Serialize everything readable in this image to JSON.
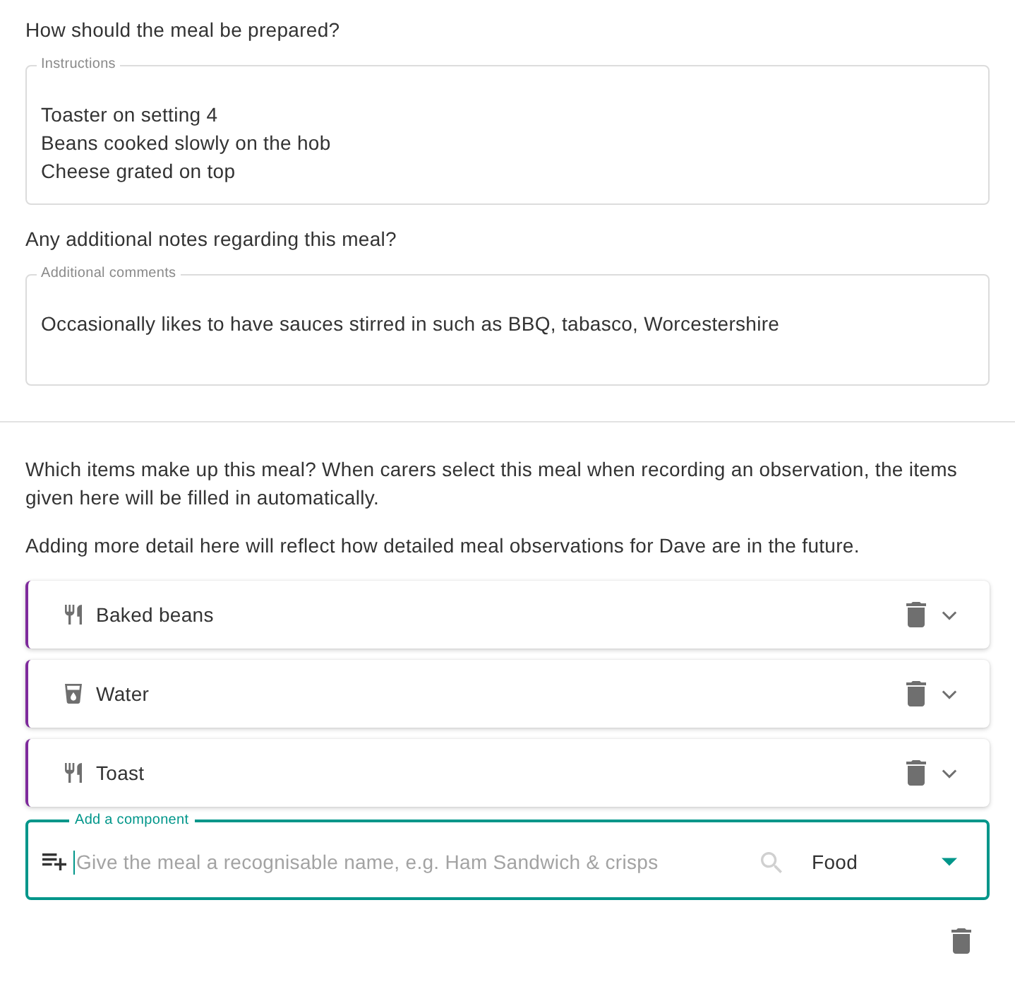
{
  "preparation": {
    "question": "How should the meal be prepared?",
    "field": {
      "label": "Instructions",
      "value": "Toaster on setting 4\nBeans cooked slowly on the hob\nCheese grated on top"
    }
  },
  "notes": {
    "question": "Any additional notes regarding this meal?",
    "field": {
      "label": "Additional comments",
      "value": "Occasionally likes to have sauces stirred in such as BBQ, tabasco, Worcestershire"
    }
  },
  "components_intro": [
    "Which items make up this meal? When carers select this meal when recording an observation, the items given here will be filled in automatically.",
    "Adding more detail here will reflect how detailed meal observations for Dave are in the future."
  ],
  "components": [
    {
      "name": "Baked beans",
      "kind": "food",
      "expanded": false
    },
    {
      "name": "Water",
      "kind": "drink",
      "expanded": false
    },
    {
      "name": "Toast",
      "kind": "food",
      "expanded": false
    }
  ],
  "add_component": {
    "label": "Add a component",
    "placeholder": "Give the meal a recognisable name, e.g. Ham Sandwich & crisps",
    "focused": true,
    "category": "Food"
  }
}
